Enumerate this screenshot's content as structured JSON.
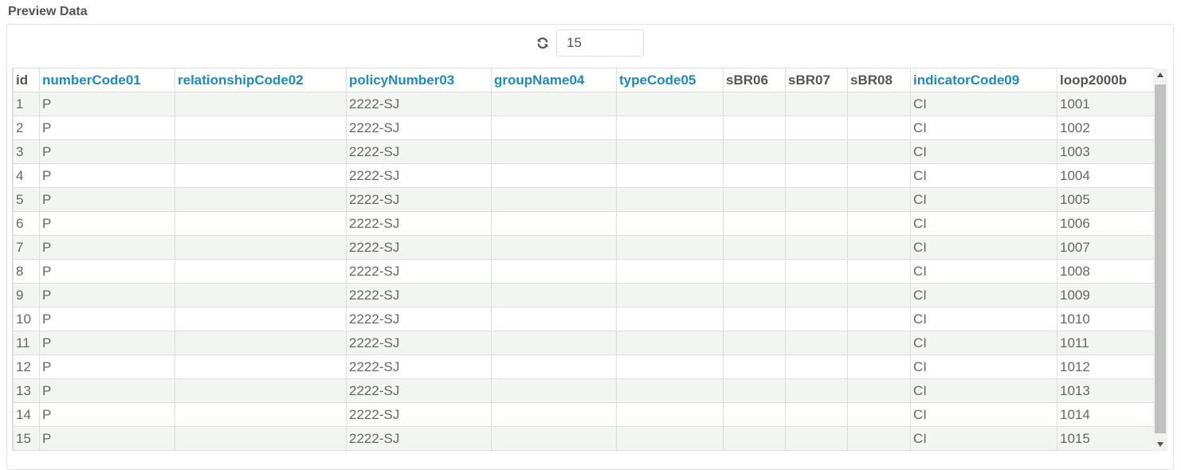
{
  "section_title": "Preview Data",
  "controls": {
    "row_count_value": "15",
    "refresh_icon": "refresh-icon"
  },
  "table": {
    "columns": [
      {
        "label": "id",
        "link": false
      },
      {
        "label": "numberCode01",
        "link": true
      },
      {
        "label": "relationshipCode02",
        "link": true
      },
      {
        "label": "policyNumber03",
        "link": true
      },
      {
        "label": "groupName04",
        "link": true
      },
      {
        "label": "typeCode05",
        "link": true
      },
      {
        "label": "sBR06",
        "link": false
      },
      {
        "label": "sBR07",
        "link": false
      },
      {
        "label": "sBR08",
        "link": false
      },
      {
        "label": "indicatorCode09",
        "link": true
      },
      {
        "label": "loop2000b",
        "link": false
      }
    ],
    "rows": [
      [
        "1",
        "P",
        "",
        "2222-SJ",
        "",
        "",
        "",
        "",
        "",
        "CI",
        "1001"
      ],
      [
        "2",
        "P",
        "",
        "2222-SJ",
        "",
        "",
        "",
        "",
        "",
        "CI",
        "1002"
      ],
      [
        "3",
        "P",
        "",
        "2222-SJ",
        "",
        "",
        "",
        "",
        "",
        "CI",
        "1003"
      ],
      [
        "4",
        "P",
        "",
        "2222-SJ",
        "",
        "",
        "",
        "",
        "",
        "CI",
        "1004"
      ],
      [
        "5",
        "P",
        "",
        "2222-SJ",
        "",
        "",
        "",
        "",
        "",
        "CI",
        "1005"
      ],
      [
        "6",
        "P",
        "",
        "2222-SJ",
        "",
        "",
        "",
        "",
        "",
        "CI",
        "1006"
      ],
      [
        "7",
        "P",
        "",
        "2222-SJ",
        "",
        "",
        "",
        "",
        "",
        "CI",
        "1007"
      ],
      [
        "8",
        "P",
        "",
        "2222-SJ",
        "",
        "",
        "",
        "",
        "",
        "CI",
        "1008"
      ],
      [
        "9",
        "P",
        "",
        "2222-SJ",
        "",
        "",
        "",
        "",
        "",
        "CI",
        "1009"
      ],
      [
        "10",
        "P",
        "",
        "2222-SJ",
        "",
        "",
        "",
        "",
        "",
        "CI",
        "1010"
      ],
      [
        "11",
        "P",
        "",
        "2222-SJ",
        "",
        "",
        "",
        "",
        "",
        "CI",
        "1011"
      ],
      [
        "12",
        "P",
        "",
        "2222-SJ",
        "",
        "",
        "",
        "",
        "",
        "CI",
        "1012"
      ],
      [
        "13",
        "P",
        "",
        "2222-SJ",
        "",
        "",
        "",
        "",
        "",
        "CI",
        "1013"
      ],
      [
        "14",
        "P",
        "",
        "2222-SJ",
        "",
        "",
        "",
        "",
        "",
        "CI",
        "1014"
      ],
      [
        "15",
        "P",
        "",
        "2222-SJ",
        "",
        "",
        "",
        "",
        "",
        "CI",
        "1015"
      ]
    ]
  },
  "colors": {
    "link": "#1a8bc4",
    "row_stripe": "#f2f5f2",
    "border": "#dddddd"
  }
}
